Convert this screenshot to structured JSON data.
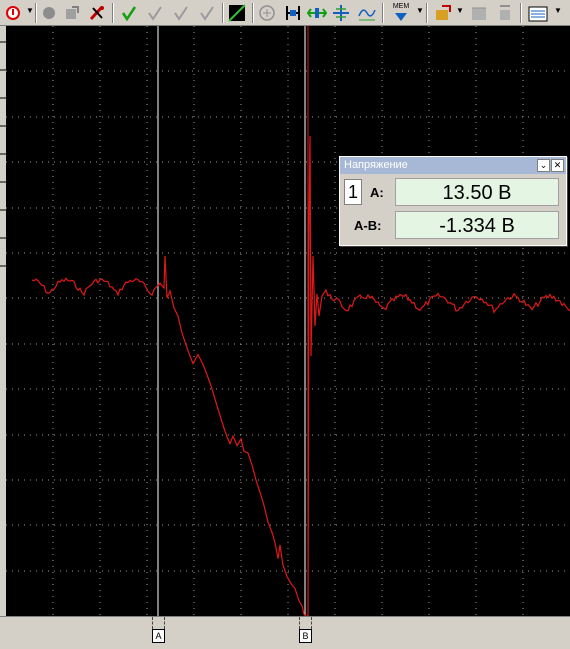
{
  "toolbar": {
    "icons": [
      "stop-icon",
      "dropdown-arrow",
      "record-circle-icon",
      "reference-icon",
      "auto-setup-icon",
      "check-icon",
      "check-faint-icon",
      "check-faint-icon-2",
      "check-faint-icon-3",
      "math-channel-icon",
      "zoom-icon",
      "channel-icon",
      "cursor-icon",
      "trigger-icon",
      "scope-graph-icon",
      "memory-icon",
      "export-icon",
      "aux-icon",
      "display-icon"
    ],
    "mem_label": "MEM"
  },
  "scope": {
    "background_color": "#000000",
    "grid_color": "#9a9a9a",
    "trace_color": "#e01818",
    "cursor_color": "#ffffff"
  },
  "cursors": {
    "a_label": "A",
    "b_label": "B"
  },
  "panel": {
    "title": "Напряжение",
    "channel_number": "1",
    "a_label": "A:",
    "a_value": "13.50 В",
    "ab_label": "A-B:",
    "ab_value": "-1.334 В"
  }
}
